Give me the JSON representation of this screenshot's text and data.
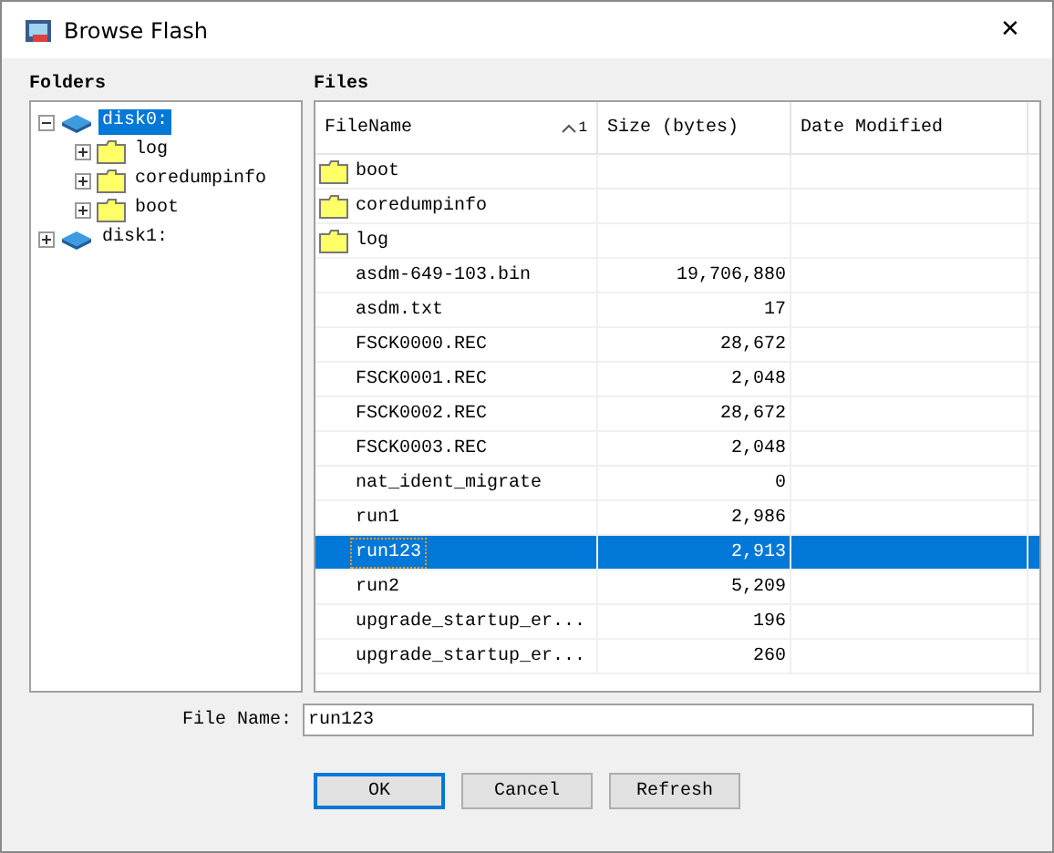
{
  "window": {
    "title": "Browse Flash",
    "close": "✕"
  },
  "folders": {
    "label": "Folders",
    "tree": [
      {
        "name": "disk0:",
        "kind": "disk",
        "selected": true,
        "expanded": true,
        "children": [
          {
            "name": "log",
            "kind": "folder",
            "selected": false,
            "expanded": false
          },
          {
            "name": "coredumpinfo",
            "kind": "folder",
            "selected": false,
            "expanded": false
          },
          {
            "name": "boot",
            "kind": "folder",
            "selected": false,
            "expanded": false
          }
        ]
      },
      {
        "name": "disk1:",
        "kind": "disk",
        "selected": false,
        "expanded": false
      }
    ]
  },
  "files": {
    "label": "Files",
    "columns": [
      {
        "title": "FileName",
        "sort": "1"
      },
      {
        "title": "Size (bytes)"
      },
      {
        "title": "Date Modified"
      }
    ],
    "rows": [
      {
        "name": "boot",
        "kind": "folder",
        "size": "",
        "selected": false
      },
      {
        "name": "coredumpinfo",
        "kind": "folder",
        "selected": false
      },
      {
        "name": "log",
        "kind": "folder",
        "selected": false
      },
      {
        "name": "asdm-649-103.bin",
        "kind": "file",
        "size": "19,706,880",
        "selected": false
      },
      {
        "name": "asdm.txt",
        "kind": "file",
        "size": "17",
        "selected": false
      },
      {
        "name": "FSCK0000.REC",
        "kind": "file",
        "size": "28,672",
        "selected": false
      },
      {
        "name": "FSCK0001.REC",
        "kind": "file",
        "size": "2,048",
        "selected": false
      },
      {
        "name": "FSCK0002.REC",
        "kind": "file",
        "size": "28,672",
        "selected": false
      },
      {
        "name": "FSCK0003.REC",
        "kind": "file",
        "size": "2,048",
        "selected": false
      },
      {
        "name": "nat_ident_migrate",
        "kind": "file",
        "size": "0",
        "selected": false
      },
      {
        "name": "run1",
        "kind": "file",
        "size": "2,986",
        "selected": false
      },
      {
        "name": "run123",
        "kind": "file",
        "size": "2,913",
        "selected": true
      },
      {
        "name": "run2",
        "kind": "file",
        "size": "5,209",
        "selected": false
      },
      {
        "name": "upgrade_startup_er...",
        "kind": "file",
        "size": "196",
        "selected": false
      },
      {
        "name": "upgrade_startup_er...",
        "kind": "file",
        "size": "260",
        "selected": false
      }
    ]
  },
  "file_name": {
    "label": "File Name:",
    "value": "run123"
  },
  "buttons": [
    {
      "label": "OK",
      "default": true
    },
    {
      "label": "Cancel",
      "default": false
    },
    {
      "label": "Refresh",
      "default": false
    }
  ]
}
